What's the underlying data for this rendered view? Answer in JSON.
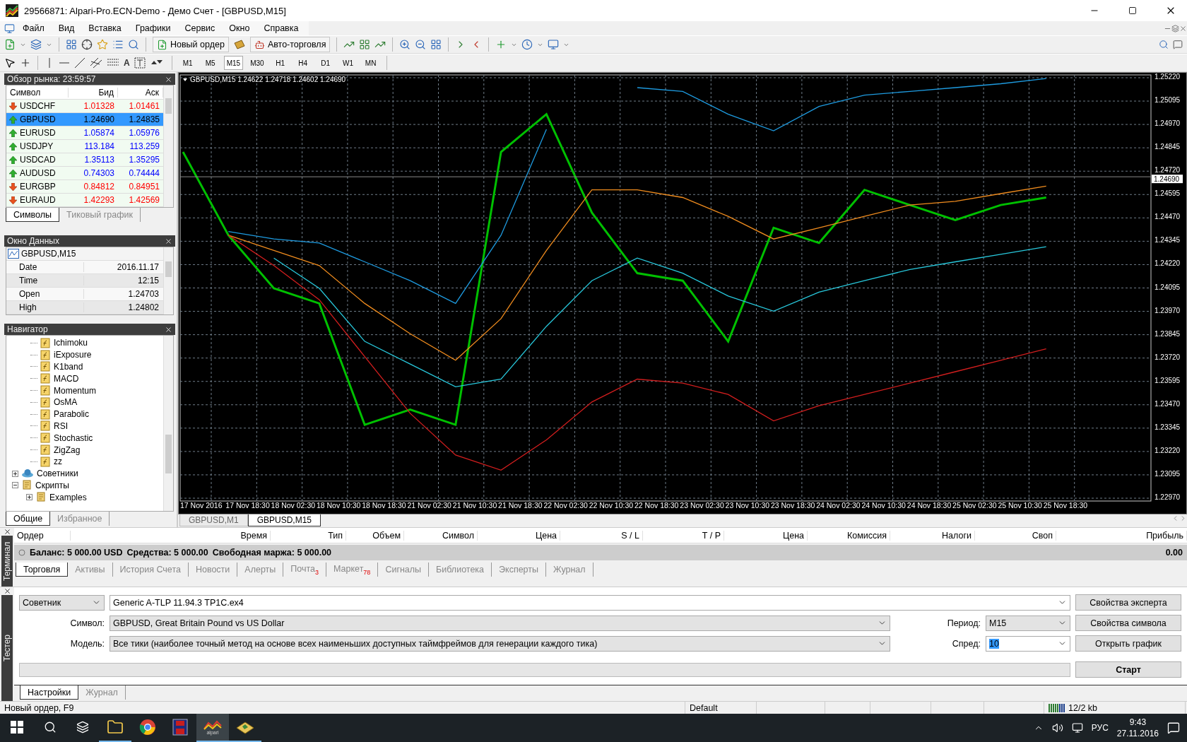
{
  "window": {
    "title": "29566871: Alpari-Pro.ECN-Demo - Демо Счет - [GBPUSD,M15]"
  },
  "menu": [
    "Файл",
    "Вид",
    "Вставка",
    "Графики",
    "Сервис",
    "Окно",
    "Справка"
  ],
  "toolbar": {
    "new_order": "Новый ордер",
    "auto_trading": "Авто-торговля",
    "text_tool": "A"
  },
  "timeframes": [
    {
      "label": "M1",
      "selected": false
    },
    {
      "label": "M5",
      "selected": false
    },
    {
      "label": "M15",
      "selected": true
    },
    {
      "label": "M30",
      "selected": false
    },
    {
      "label": "H1",
      "selected": false
    },
    {
      "label": "H4",
      "selected": false
    },
    {
      "label": "D1",
      "selected": false
    },
    {
      "label": "W1",
      "selected": false
    },
    {
      "label": "MN",
      "selected": false
    }
  ],
  "market_watch": {
    "title": "Обзор рынка: 23:59:57",
    "columns": [
      "Символ",
      "Бид",
      "Аск"
    ],
    "rows": [
      {
        "symbol": "USDCHF",
        "bid": "1.01328",
        "ask": "1.01461",
        "up": false,
        "selected": false
      },
      {
        "symbol": "GBPUSD",
        "bid": "1.24690",
        "ask": "1.24835",
        "up": true,
        "selected": true
      },
      {
        "symbol": "EURUSD",
        "bid": "1.05874",
        "ask": "1.05976",
        "up": true,
        "selected": false
      },
      {
        "symbol": "USDJPY",
        "bid": "113.184",
        "ask": "113.259",
        "up": true,
        "selected": false
      },
      {
        "symbol": "USDCAD",
        "bid": "1.35113",
        "ask": "1.35295",
        "up": true,
        "selected": false
      },
      {
        "symbol": "AUDUSD",
        "bid": "0.74303",
        "ask": "0.74444",
        "up": true,
        "selected": false
      },
      {
        "symbol": "EURGBP",
        "bid": "0.84812",
        "ask": "0.84951",
        "up": false,
        "selected": false
      },
      {
        "symbol": "EURAUD",
        "bid": "1.42293",
        "ask": "1.42569",
        "up": false,
        "selected": false
      }
    ],
    "tabs": [
      {
        "label": "Символы",
        "selected": true
      },
      {
        "label": "Тиковый график",
        "selected": false
      }
    ]
  },
  "data_window": {
    "title": "Окно Данных",
    "header": "GBPUSD,M15",
    "rows": [
      {
        "label": "Date",
        "value": "2016.11.17"
      },
      {
        "label": "Time",
        "value": "12:15"
      },
      {
        "label": "Open",
        "value": "1.24703"
      },
      {
        "label": "High",
        "value": "1.24802"
      }
    ]
  },
  "navigator": {
    "title": "Навигатор",
    "indicators": [
      "Ichimoku",
      "iExposure",
      "K1band",
      "MACD",
      "Momentum",
      "OsMA",
      "Parabolic",
      "RSI",
      "Stochastic",
      "ZigZag",
      "zz"
    ],
    "tree": [
      {
        "label": "Советники",
        "kind": "experts",
        "expanded": false
      },
      {
        "label": "Скрипты",
        "kind": "scripts",
        "expanded": true,
        "children": [
          {
            "label": "Examples",
            "kind": "scripts",
            "expanded": false
          }
        ]
      }
    ],
    "tabs": [
      {
        "label": "Общие",
        "selected": true
      },
      {
        "label": "Избранное",
        "selected": false
      }
    ]
  },
  "chart": {
    "chart_data": {
      "type": "line",
      "title": "GBPUSD,M15 1.24622 1.24718 1.24602 1.24690",
      "x": [
        "17 Nov 2016",
        "17 Nov 18:30",
        "18 Nov 02:30",
        "18 Nov 10:30",
        "18 Nov 18:30",
        "21 Nov 02:30",
        "21 Nov 10:30",
        "21 Nov 18:30",
        "22 Nov 02:30",
        "22 Nov 10:30",
        "22 Nov 18:30",
        "23 Nov 02:30",
        "23 Nov 10:30",
        "23 Nov 18:30",
        "24 Nov 02:30",
        "24 Nov 10:30",
        "24 Nov 18:30",
        "25 Nov 02:30",
        "25 Nov 10:30",
        "25 Nov 18:30"
      ],
      "ylim": [
        1.2297,
        1.2522
      ],
      "yticks": [
        {
          "value": 1.2522,
          "label": "1.25220"
        },
        {
          "value": 1.25095,
          "label": "1.25095"
        },
        {
          "value": 1.2497,
          "label": "1.24970"
        },
        {
          "value": 1.24845,
          "label": "1.24845"
        },
        {
          "value": 1.2472,
          "label": "1.24720"
        },
        {
          "value": 1.24595,
          "label": "1.24595"
        },
        {
          "value": 1.2447,
          "label": "1.24470"
        },
        {
          "value": 1.24345,
          "label": "1.24345"
        },
        {
          "value": 1.2422,
          "label": "1.24220"
        },
        {
          "value": 1.24095,
          "label": "1.24095"
        },
        {
          "value": 1.2397,
          "label": "1.23970"
        },
        {
          "value": 1.23845,
          "label": "1.23845"
        },
        {
          "value": 1.2372,
          "label": "1.23720"
        },
        {
          "value": 1.23595,
          "label": "1.23595"
        },
        {
          "value": 1.2347,
          "label": "1.23470"
        },
        {
          "value": 1.23345,
          "label": "1.23345"
        },
        {
          "value": 1.2322,
          "label": "1.23220"
        },
        {
          "value": 1.23095,
          "label": "1.23095"
        },
        {
          "value": 1.2297,
          "label": "1.22970"
        }
      ],
      "series": [
        {
          "color": "#00c000",
          "values": [
            1.24823,
            1.24377,
            1.24093,
            1.24012,
            1.23363,
            1.23444,
            1.23363,
            1.24823,
            1.25025,
            1.24498,
            1.24174,
            1.24134,
            1.23809,
            1.24417,
            1.24336,
            1.2462,
            1.24539,
            1.24458,
            1.24539,
            1.24579
          ]
        },
        {
          "color": "#1e9be0",
          "values": [
            null,
            1.24397,
            1.24357,
            1.24336,
            1.24235,
            1.24134,
            1.24012,
            1.24377,
            1.24944,
            null,
            1.25167,
            1.25147,
            1.25025,
            1.24936,
            1.25066,
            1.25127,
            1.25147,
            1.25167,
            1.25188,
            1.25216
          ]
        },
        {
          "color": "#f08c1e",
          "values": [
            null,
            1.24377,
            1.24296,
            1.24215,
            1.24012,
            1.2385,
            1.23708,
            1.23931,
            1.24296,
            1.2462,
            1.2462,
            1.24579,
            1.24478,
            1.24357,
            1.24417,
            1.24478,
            1.24539,
            1.24559,
            1.246,
            1.2464
          ]
        },
        {
          "color": "#28c8dc",
          "values": [
            null,
            null,
            1.24255,
            1.24093,
            1.23809,
            1.23688,
            1.23566,
            1.23607,
            1.2389,
            1.24134,
            1.24255,
            1.24174,
            1.24052,
            1.23971,
            1.24073,
            1.24134,
            1.24194,
            1.24235,
            1.24275,
            1.24316
          ]
        },
        {
          "color": "#d21e1e",
          "values": [
            null,
            1.24377,
            1.24215,
            1.24032,
            1.23728,
            1.23424,
            1.23201,
            1.2312,
            1.23282,
            1.23485,
            1.23607,
            1.23586,
            1.23525,
            1.23384,
            1.23465,
            1.23525,
            1.23586,
            1.23647,
            1.23708,
            1.23769
          ]
        }
      ],
      "grid": true,
      "ref_lines": [
        {
          "axis": "y",
          "value": 1.2469,
          "label": "1.24690"
        }
      ]
    }
  },
  "chart_tabs": [
    {
      "label": "GBPUSD,M1",
      "selected": false
    },
    {
      "label": "GBPUSD,M15",
      "selected": true
    }
  ],
  "terminal": {
    "label": "Терминал",
    "columns": [
      "Ордер",
      "Время",
      "Тип",
      "Объем",
      "Символ",
      "Цена",
      "S / L",
      "T / P",
      "Цена",
      "Комиссия",
      "Налоги",
      "Своп",
      "Прибыль"
    ],
    "balance": [
      "Баланс: 5 000.00 USD",
      "Средства: 5 000.00",
      "Свободная маржа: 5 000.00"
    ],
    "profit": "0.00",
    "tabs": [
      {
        "label": "Торговля",
        "selected": true
      },
      {
        "label": "Активы",
        "selected": false
      },
      {
        "label": "История Счета",
        "selected": false
      },
      {
        "label": "Новости",
        "selected": false
      },
      {
        "label": "Алерты",
        "selected": false
      },
      {
        "label": "Почта",
        "badge": "3",
        "selected": false
      },
      {
        "label": "Маркет",
        "badge": "78",
        "selected": false
      },
      {
        "label": "Сигналы",
        "selected": false
      },
      {
        "label": "Библиотека",
        "selected": false
      },
      {
        "label": "Эксперты",
        "selected": false
      },
      {
        "label": "Журнал",
        "selected": false
      }
    ]
  },
  "tester": {
    "label": "Тестер",
    "mode": "Советник",
    "expert": "Generic A-TLP 11.94.3 TP1C.ex4",
    "fields": [
      {
        "label": "Символ:",
        "value": "GBPUSD, Great Britain Pound vs US Dollar"
      },
      {
        "label": "Модель:",
        "value": "Все тики (наиболее точный метод на основе всех наименьших доступных таймфреймов для генерации каждого тика)"
      }
    ],
    "side_fields": [
      {
        "label": "Период:",
        "value": "M15",
        "editable": false,
        "text_selected": false
      },
      {
        "label": "Спред:",
        "value": "10",
        "editable": true,
        "text_selected": true
      }
    ],
    "buttons": [
      "Свойства эксперта",
      "Свойства символа",
      "Открыть график"
    ],
    "start": "Старт",
    "progress": {
      "level": 0
    },
    "tabs": [
      {
        "label": "Настройки",
        "selected": true
      },
      {
        "label": "Журнал",
        "selected": false
      }
    ]
  },
  "status_bar": {
    "hint": "Новый ордер, F9",
    "profile": "Default",
    "traffic": "12/2 kb"
  },
  "taskbar": {
    "apps": [
      {
        "kind": "explorer",
        "running": true,
        "active": false
      },
      {
        "kind": "chrome",
        "running": false,
        "active": false
      },
      {
        "kind": "floppy",
        "running": false,
        "active": false
      },
      {
        "kind": "alpari",
        "label": "alpari",
        "running": true,
        "active": true
      },
      {
        "kind": "book",
        "running": true,
        "active": false
      }
    ],
    "language": "РУС",
    "time": "9:43",
    "date": "27.11.2016"
  }
}
